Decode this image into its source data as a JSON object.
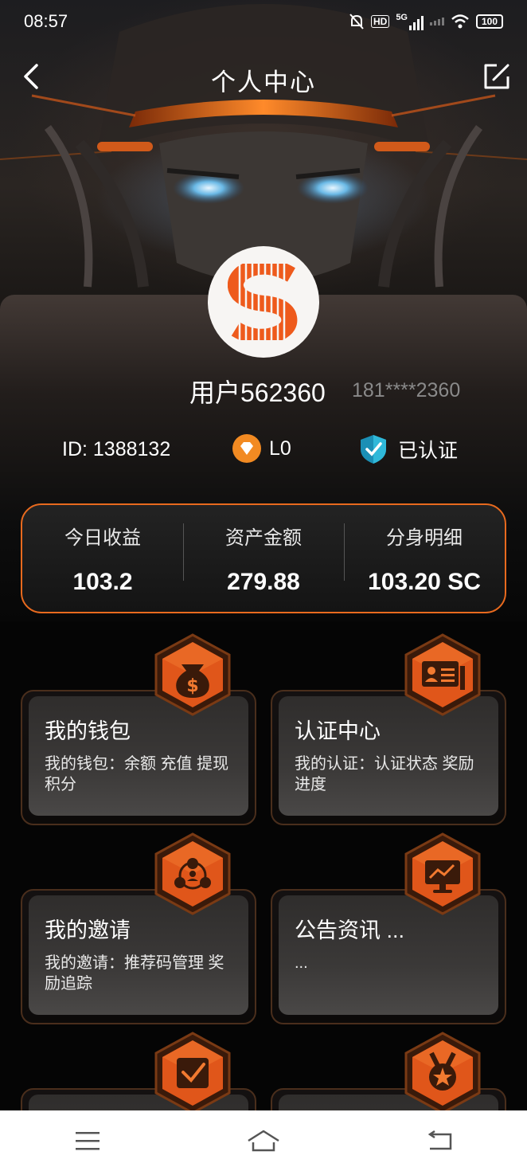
{
  "status_bar": {
    "time": "08:57",
    "signal_label": "5G",
    "hd_label": "HD",
    "battery": "100",
    "icons": [
      "mute-bell-icon",
      "hd-icon",
      "signal-5g-icon",
      "signal-bars-icon",
      "wifi-icon",
      "battery-icon"
    ]
  },
  "header": {
    "title": "个人中心",
    "back_icon": "chevron-left-icon",
    "edit_icon": "edit-icon"
  },
  "profile": {
    "avatar_icon": "s-logo-icon",
    "username": "用户562360",
    "phone": "181****2360",
    "id_text": "ID: 1388132",
    "level": "L0",
    "verified": "已认证"
  },
  "stats": [
    {
      "label": "今日收益",
      "value": "103.2"
    },
    {
      "label": "资产金额",
      "value": "279.88"
    },
    {
      "label": "分身明细",
      "value": "103.20 SC"
    }
  ],
  "menu": [
    {
      "title": "我的钱包",
      "desc": "我的钱包：余额 充值 提现 积分",
      "icon": "money-bag-icon"
    },
    {
      "title": "认证中心",
      "desc": "我的认证：认证状态 奖励进度",
      "icon": "id-card-icon"
    },
    {
      "title": "我的邀请",
      "desc": "我的邀请：推荐码管理 奖励追踪",
      "icon": "network-icon"
    },
    {
      "title": "公告资讯 ...",
      "desc": "...",
      "icon": "presentation-icon"
    },
    {
      "title": "",
      "desc": "",
      "icon": "checkbox-icon"
    },
    {
      "title": "",
      "desc": "",
      "icon": "medal-icon"
    }
  ],
  "nav": [
    "menu-icon",
    "home-icon",
    "back-icon"
  ],
  "colors": {
    "accent": "#e86a1e",
    "panel": "#0d0d0d"
  }
}
